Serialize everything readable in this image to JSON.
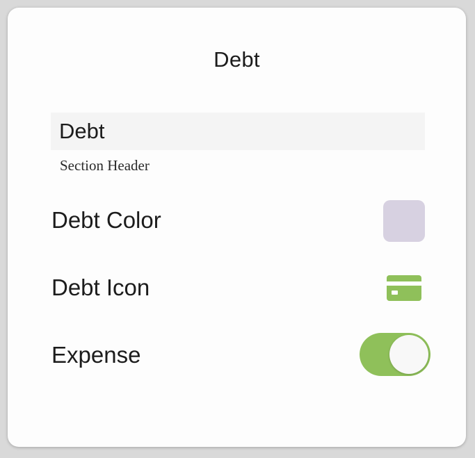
{
  "dialog": {
    "title": "Debt",
    "name_value": "Debt",
    "section_header_label": "Section Header"
  },
  "rows": [
    {
      "label": "Debt Color"
    },
    {
      "label": "Debt Icon"
    },
    {
      "label": "Expense"
    }
  ],
  "color_swatch": "#d7d1e1",
  "icon": {
    "name": "credit-card-icon",
    "color": "#8fc05a"
  },
  "expense_toggle": {
    "on": true,
    "color": "#8fc05a"
  }
}
